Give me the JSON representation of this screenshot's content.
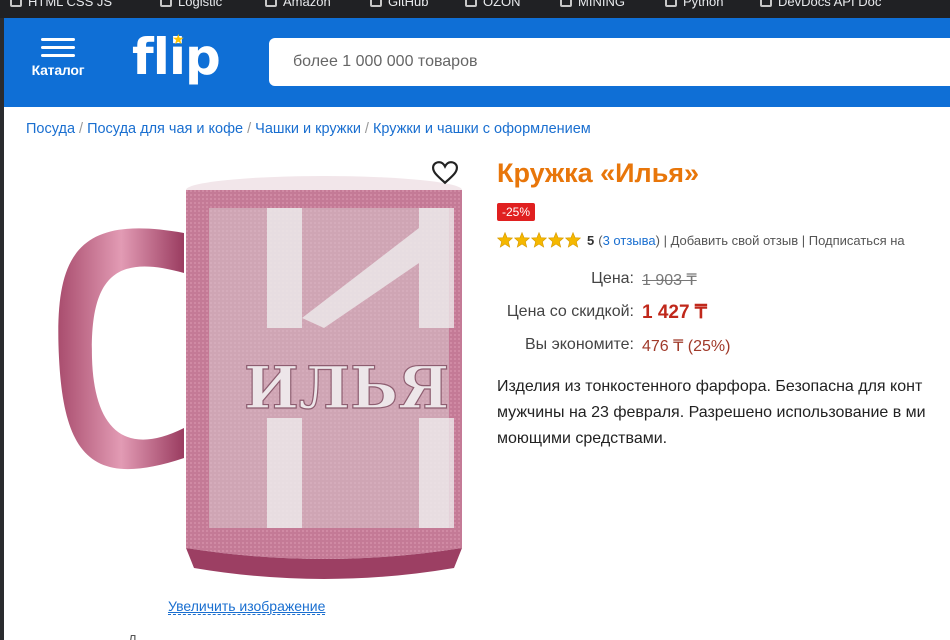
{
  "bookmarks": [
    {
      "label": "HTML CSS JS"
    },
    {
      "label": "Logistic"
    },
    {
      "label": "Amazon"
    },
    {
      "label": "GitHub"
    },
    {
      "label": "OZON"
    },
    {
      "label": "MINING"
    },
    {
      "label": "Python"
    },
    {
      "label": "DevDocs API Doc"
    }
  ],
  "header": {
    "catalog_label": "Каталог",
    "logo_text": "flip",
    "search_placeholder": "более 1 000 000 товаров",
    "brand_color": "#0f6fd6"
  },
  "breadcrumb": [
    "Посуда",
    "Посуда для чая и кофе",
    "Чашки и кружки",
    "Кружки и чашки с оформлением"
  ],
  "product": {
    "title": "Кружка «Илья»",
    "discount_badge": "-25%",
    "rating_value": "5",
    "reviews_link": "3 отзыва",
    "add_review": "Добавить свой отзыв",
    "subscribe": "Подписаться на",
    "stars": 5,
    "price_label": "Цена:",
    "price_old": "1 903 ₸",
    "price_discount_label": "Цена со скидкой:",
    "price_new": "1 427 ₸",
    "savings_label": "Вы экономите:",
    "savings_value": "476 ₸ (25%)",
    "description": "Изделия из тонкостенного фарфора. Безопасна для конт мужчины на 23 февраля. Разрешено использование в ми моющими средствами.",
    "mug_text": "ИЛЬЯ",
    "zoom_link": "Увеличить изображение",
    "below_text": "Д"
  }
}
